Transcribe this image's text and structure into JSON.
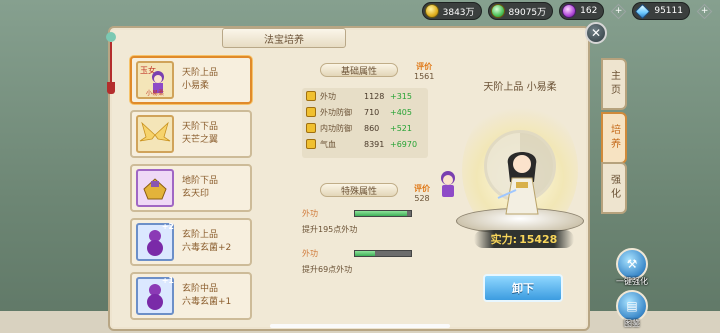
{
  "currency": {
    "gold": "3843万",
    "jade": "89075万",
    "orb": "162",
    "diamond": "95111"
  },
  "panel": {
    "title": "法宝培养"
  },
  "items": [
    {
      "grade": "天阶上品",
      "name": "小易柔",
      "badge": ""
    },
    {
      "grade": "天阶下品",
      "name": "天芒之翼",
      "badge": ""
    },
    {
      "grade": "地阶下品",
      "name": "玄天印",
      "badge": ""
    },
    {
      "grade": "玄阶上品",
      "name": "六毒玄菌+2",
      "badge": "+2"
    },
    {
      "grade": "玄阶中品",
      "name": "六毒玄菌+1",
      "badge": "+1"
    }
  ],
  "base_attr": {
    "header": "基础属性",
    "rating_label": "评价",
    "rating_value": "1561",
    "stats": [
      {
        "name": "外功",
        "value": "1128",
        "bonus": "+315"
      },
      {
        "name": "外功防御",
        "value": "710",
        "bonus": "+405"
      },
      {
        "name": "内功防御",
        "value": "860",
        "bonus": "+521"
      },
      {
        "name": "气血",
        "value": "8391",
        "bonus": "+6970"
      }
    ]
  },
  "special_attr": {
    "header": "特殊属性",
    "rating_label": "评价",
    "rating_value": "528",
    "rows": [
      {
        "name": "外功",
        "desc": "提升195点外功",
        "fill": 0.92
      },
      {
        "name": "外功",
        "desc": "提升69点外功",
        "fill": 0.35
      }
    ]
  },
  "display": {
    "title": "天阶上品 小易柔",
    "power_label": "实力:",
    "power_value": "15428"
  },
  "unequip_label": "卸下",
  "tabs": [
    {
      "label": "主页",
      "active": false
    },
    {
      "label": "培养",
      "active": true
    },
    {
      "label": "强化",
      "active": false
    }
  ],
  "side_buttons": {
    "one_key": "一键强化",
    "codex": "图鉴"
  },
  "colors": {
    "accent_orange": "#e07a1a",
    "bonus_green": "#27a335",
    "power_gold": "#f7d55a"
  }
}
